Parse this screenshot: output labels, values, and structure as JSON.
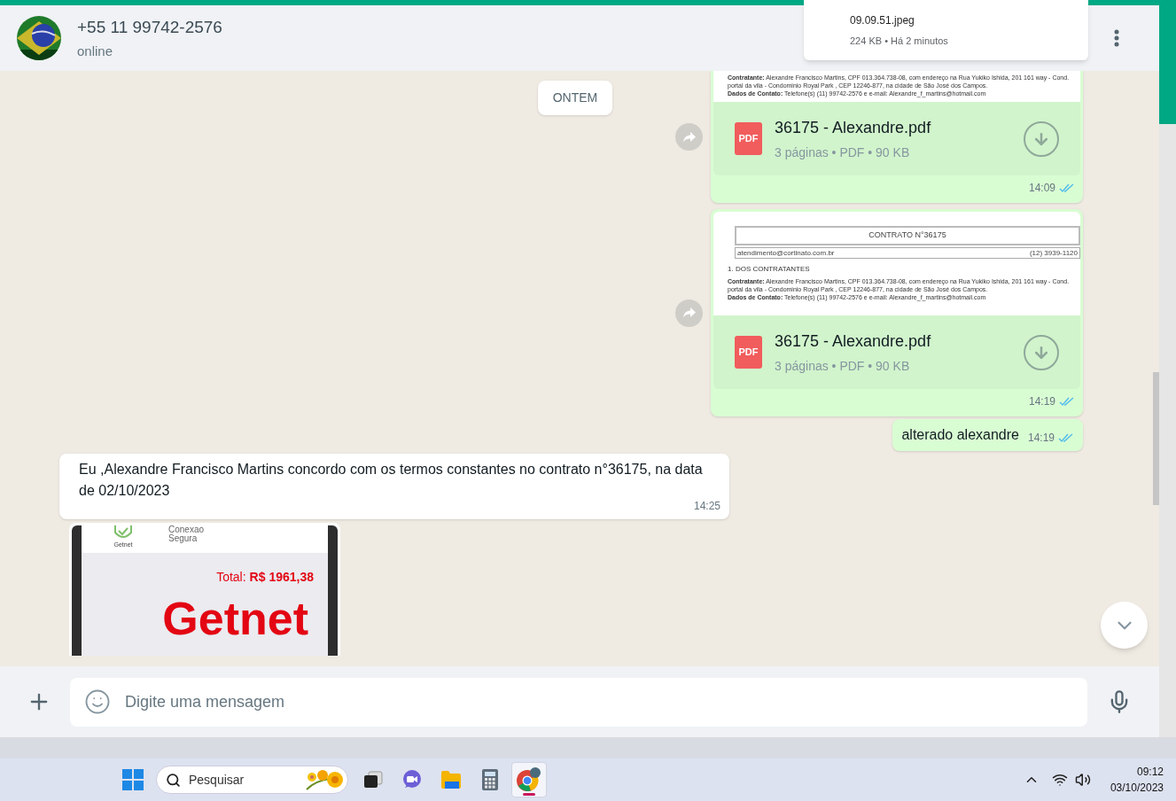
{
  "header": {
    "contact": "+55 11 99742-2576",
    "status": "online"
  },
  "download_popup": {
    "file": "09.09.51.jpeg",
    "details": "224 KB • Há 2 minutos"
  },
  "date_chip": "ONTEM",
  "messages": [
    {
      "kind": "document",
      "outgoing": true,
      "forward": true,
      "preview": {
        "paragraphs": [
          "**Contratante:** Alexandre Francisco Martins, CPF 013.364.738-08, com endereço na Rua Yukiko Ishida, 201 161 way - Cond. portal da vila - Condominio Royal Park , CEP 12246-877, na cidade de São José dos Campos.",
          "**Dados de Contato:** Telefone(s) (11) 99742-2576 e e-mail: Alexandre_f_martins@hotmail.com"
        ]
      },
      "file": "36175 - Alexandre.pdf",
      "file_icon": "PDF",
      "meta": "3 páginas • PDF • 90 KB",
      "time": "14:09",
      "read": true
    },
    {
      "kind": "document",
      "outgoing": true,
      "forward": true,
      "preview": {
        "title": "CONTRATO N°36175",
        "email": "atendimento@cortinato.com.br",
        "phone": "(12) 3939-1120",
        "section": "1. DOS CONTRATANTES",
        "paragraphs": [
          "**Contratante:** Alexandre Francisco Martins, CPF 013.364.738-08, com endereço na Rua Yukiko Ishida, 201 161 way - Cond. portal da vila - Condominio Royal Park , CEP 12246-877, na cidade de São José dos Campos.",
          "**Dados de Contato:** Telefone(s) (11) 99742-2576 e e-mail: Alexandre_f_martins@hotmail.com"
        ]
      },
      "file": "36175 - Alexandre.pdf",
      "file_icon": "PDF",
      "meta": "3 páginas • PDF • 90 KB",
      "time": "14:19",
      "read": true
    },
    {
      "kind": "text",
      "outgoing": true,
      "text": "alterado alexandre",
      "time": "14:19",
      "read": true
    },
    {
      "kind": "text",
      "outgoing": false,
      "text": "Eu ,Alexandre Francisco Martins concordo com os termos constantes no contrato n°36175, na data de 02/10/2023",
      "time": "14:25"
    },
    {
      "kind": "screenshot",
      "brand_small": "Getnet",
      "secure": "Conexao Segura",
      "total_label": "Total:",
      "total_value": "R$ 1961,38",
      "brand_big": "Getnet"
    }
  ],
  "composer": {
    "placeholder": "Digite uma mensagem"
  },
  "taskbar": {
    "search": "Pesquisar",
    "apps": [
      {
        "kind": "task-view",
        "selected": false
      },
      {
        "kind": "chat",
        "selected": false
      },
      {
        "kind": "folder",
        "selected": false
      },
      {
        "kind": "calculator",
        "selected": false
      },
      {
        "kind": "browser",
        "selected": true
      }
    ],
    "time": "09:12",
    "date": "03/10/2023"
  }
}
